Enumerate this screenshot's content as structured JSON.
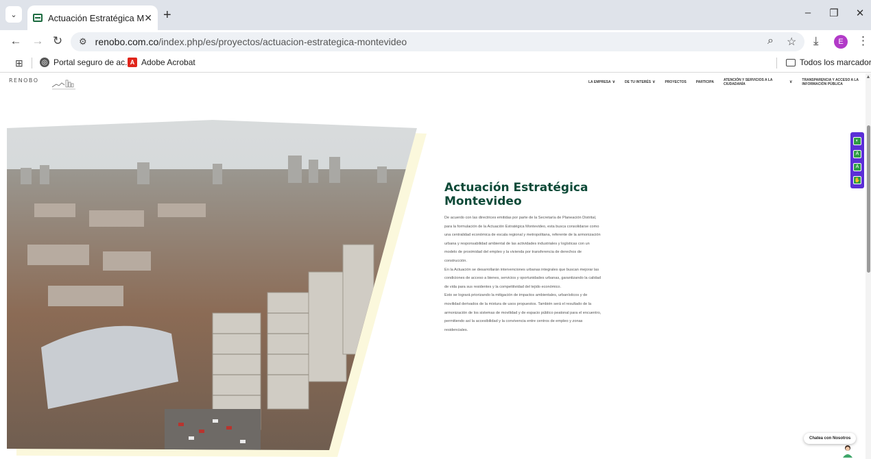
{
  "browser": {
    "tab_title": "Actuación Estratégica Montevid",
    "tab_close": "✕",
    "new_tab": "+",
    "url_host": "renobo.com.co",
    "url_path": "/index.php/es/proyectos/actuacion-estrategica-montevideo",
    "profile_initial": "E",
    "bookmarks": [
      {
        "label": "Portal seguro de ac...",
        "icon": "globe-icon"
      },
      {
        "label": "Adobe Acrobat",
        "icon": "acrobat-icon"
      }
    ],
    "all_bookmarks_label": "Todos los marcadores"
  },
  "site": {
    "logo_text": "RENOBO",
    "nav": [
      {
        "label": "LA EMPRESA",
        "has_menu": true
      },
      {
        "label": "DE TU INTERÉS",
        "has_menu": true
      },
      {
        "label": "PROYECTOS",
        "has_menu": false
      },
      {
        "label": "PARTICIPA",
        "has_menu": false
      },
      {
        "label": "ATENCIÓN Y SERVICIOS A LA CIUDADANÍA",
        "has_menu": true
      },
      {
        "label": "TRANSPARENCIA Y ACCESO A LA INFORMACIÓN PÚBLICA",
        "has_menu": false
      }
    ]
  },
  "hero": {
    "title": "Actuación Estratégica Montevideo",
    "paragraphs": [
      "De acuerdo con las directrices emitidas por parte de la Secretaría de Planeación Distrital, para la formulación de la Actuación Estratégica Montevideo, esta busca consolidarse como una centralidad económica de escala regional y metropolitana, referente de la armonización urbana y responsabilidad ambiental de las actividades industriales y logísticas con un modelo de proximidad del empleo y la vivienda por transferencia de derechos de construcción.",
      "En la Actuación se desarrollarán intervenciones urbanas integrales que buscan mejorar las condiciones de acceso a bienes, servicios y oportunidades urbanas, garantizando la calidad de vida para sus residentes y la competitividad del tejido económico.",
      "Esto se logrará priorizando la mitigación de impactos ambientales, urbanísticos y de movilidad derivados de la mixtura de usos propuestos. También será el resultado de la armonización de los sistemas de movilidad y de espacio público peatonal para el encuentro, permitiendo así la accesibilidad y la convivencia entre centros de empleo y zonas residenciales."
    ]
  },
  "chat": {
    "label": "Chatea con Nosotros"
  },
  "colors": {
    "title": "#0e4a38",
    "a11y_bar": "#5b2fd6",
    "a11y_btn": "#2f9e44"
  }
}
